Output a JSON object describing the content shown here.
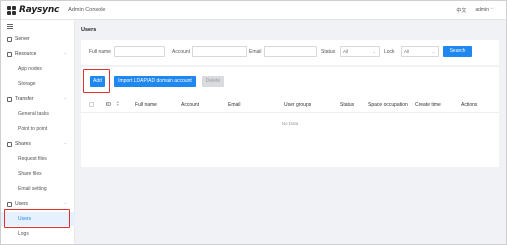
{
  "header": {
    "brand": "Raysync",
    "title": "Admin Console",
    "language": "中文",
    "user": "admin"
  },
  "sidebar": {
    "items": [
      {
        "label": "Server",
        "type": "group",
        "icon": "server-icon"
      },
      {
        "label": "Resource",
        "type": "group",
        "icon": "resource-icon"
      },
      {
        "label": "App nodes",
        "type": "sub"
      },
      {
        "label": "Storage",
        "type": "sub"
      },
      {
        "label": "Transfer",
        "type": "group",
        "icon": "transfer-icon"
      },
      {
        "label": "General tasks",
        "type": "sub"
      },
      {
        "label": "Point to point",
        "type": "sub"
      },
      {
        "label": "Shares",
        "type": "group",
        "icon": "shares-icon"
      },
      {
        "label": "Request files",
        "type": "sub"
      },
      {
        "label": "Share files",
        "type": "sub"
      },
      {
        "label": "Email setting",
        "type": "sub"
      },
      {
        "label": "Users",
        "type": "group",
        "icon": "users-icon"
      },
      {
        "label": "Users",
        "type": "sub",
        "active": true
      },
      {
        "label": "Logs",
        "type": "sub"
      }
    ]
  },
  "page": {
    "title": "Users"
  },
  "filters": {
    "full_name_label": "Full name",
    "account_label": "Account",
    "email_label": "Email",
    "status_label": "Status",
    "status_value": "All",
    "lock_label": "Lock",
    "lock_value": "All",
    "search_label": "Search"
  },
  "toolbar": {
    "add_label": "Add",
    "import_label": "Import LDAP/AD domain account",
    "delete_label": "Delete"
  },
  "table": {
    "columns": [
      "ID",
      "Full name",
      "Account",
      "Email",
      "User groups",
      "Status",
      "Space occupation",
      "Create time",
      "Actions"
    ],
    "empty_text": "No Data"
  },
  "colors": {
    "accent": "#1e87f0",
    "highlight": "#e03030",
    "active_bg": "#e6f1fd"
  }
}
